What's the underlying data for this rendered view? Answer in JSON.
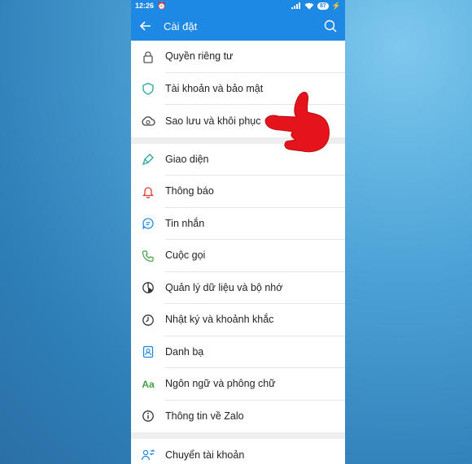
{
  "status_bar": {
    "time": "12:26",
    "battery": "87"
  },
  "header": {
    "title": "Cài đặt"
  },
  "colors": {
    "accent": "#1e88e5",
    "hand": "#e5141b"
  },
  "settings": {
    "group1": [
      {
        "label": "Quyền riêng tư",
        "icon": "lock-icon"
      },
      {
        "label": "Tài khoản và bảo mật",
        "icon": "shield-icon"
      },
      {
        "label": "Sao lưu và khôi phục",
        "icon": "cloud-icon"
      }
    ],
    "group2": [
      {
        "label": "Giao diện",
        "icon": "brush-icon"
      },
      {
        "label": "Thông báo",
        "icon": "bell-icon"
      },
      {
        "label": "Tin nhắn",
        "icon": "chat-icon"
      },
      {
        "label": "Cuộc gọi",
        "icon": "phone-icon"
      },
      {
        "label": "Quản lý dữ liệu và bộ nhớ",
        "icon": "pie-chart-icon"
      },
      {
        "label": "Nhật ký và khoảnh khắc",
        "icon": "clock-icon"
      },
      {
        "label": "Danh bạ",
        "icon": "contacts-icon"
      },
      {
        "label": "Ngôn ngữ và phông chữ",
        "icon": "language-icon",
        "icon_text": "Aa"
      },
      {
        "label": "Thông tin về Zalo",
        "icon": "info-icon"
      }
    ],
    "group3": [
      {
        "label": "Chuyển tài khoản",
        "icon": "switch-account-icon"
      }
    ]
  }
}
